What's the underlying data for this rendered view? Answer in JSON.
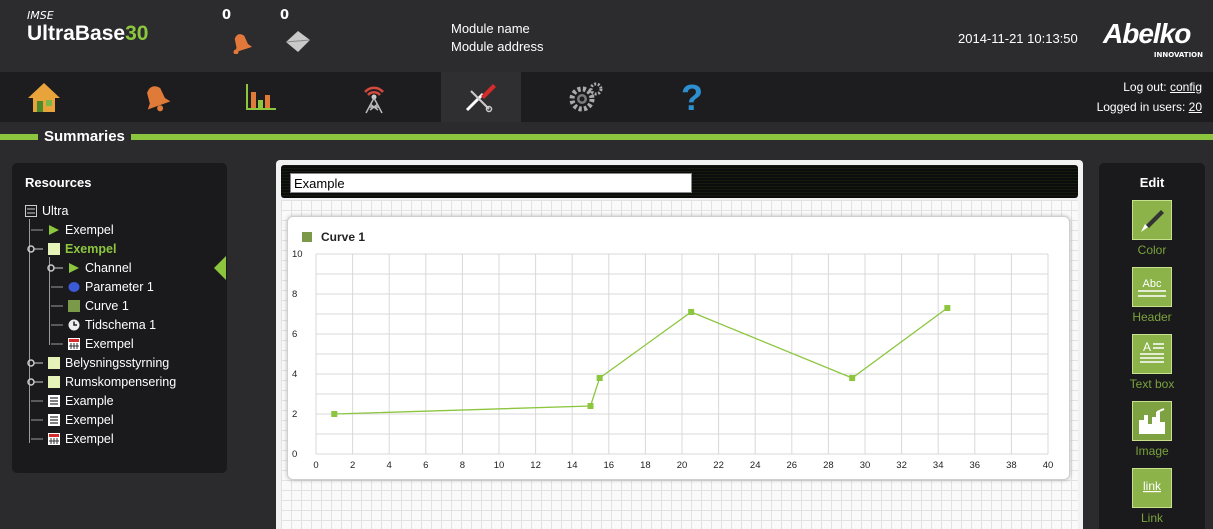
{
  "header": {
    "brand_small": "IMSE",
    "brand_main": "UltraBase",
    "brand_num": "30",
    "alarm_count": "0",
    "message_count": "0",
    "module_name": "Module name",
    "module_address": "Module address",
    "datetime": "2014-11-21 10:13:50",
    "logo_name": "Abelko",
    "logo_sub": "INNOVATION"
  },
  "nav": {
    "items": [
      "home-icon",
      "bell-icon",
      "chart-icon",
      "antenna-icon",
      "tools-icon",
      "gears-icon",
      "help-icon"
    ],
    "active": "tools-icon",
    "logout_label": "Log out: ",
    "logout_user": "config",
    "logged_label": "Logged in users: ",
    "logged_count": "20"
  },
  "section": {
    "title": "Summaries"
  },
  "resources": {
    "title": "Resources",
    "tree": [
      {
        "label": "Ultra"
      },
      {
        "label": "Exempel"
      },
      {
        "label": "Exempel"
      },
      {
        "label": "Channel"
      },
      {
        "label": "Parameter 1"
      },
      {
        "label": "Curve 1"
      },
      {
        "label": "Tidschema 1"
      },
      {
        "label": "Exempel"
      },
      {
        "label": "Belysningsstyrning"
      },
      {
        "label": "Rumskompensering"
      },
      {
        "label": "Example"
      },
      {
        "label": "Exempel"
      },
      {
        "label": "Exempel"
      }
    ]
  },
  "canvas": {
    "title_value": "Example"
  },
  "edit": {
    "title": "Edit",
    "tools": [
      "Color",
      "Header",
      "Text box",
      "Image",
      "Link"
    ],
    "icon_abc": "Abc",
    "icon_link": "link"
  },
  "colors": {
    "accent": "#8cc63f",
    "panel": "#1a1a1c",
    "tool": "#8bb34a"
  },
  "chart_data": {
    "type": "line",
    "series": [
      {
        "name": "Curve 1",
        "x": [
          1,
          15,
          15.5,
          20.5,
          29.3,
          34.5
        ],
        "y": [
          2.0,
          2.4,
          3.8,
          7.1,
          3.8,
          7.3
        ]
      }
    ],
    "xlim": [
      0,
      40
    ],
    "ylim": [
      0,
      10
    ],
    "x_ticks": [
      0,
      2,
      4,
      6,
      8,
      10,
      12,
      14,
      16,
      18,
      20,
      22,
      24,
      26,
      28,
      30,
      32,
      34,
      36,
      38,
      40
    ],
    "y_ticks": [
      0,
      2,
      4,
      6,
      8,
      10
    ],
    "grid": true,
    "legend": "top-left",
    "color": "#8cc63f"
  }
}
